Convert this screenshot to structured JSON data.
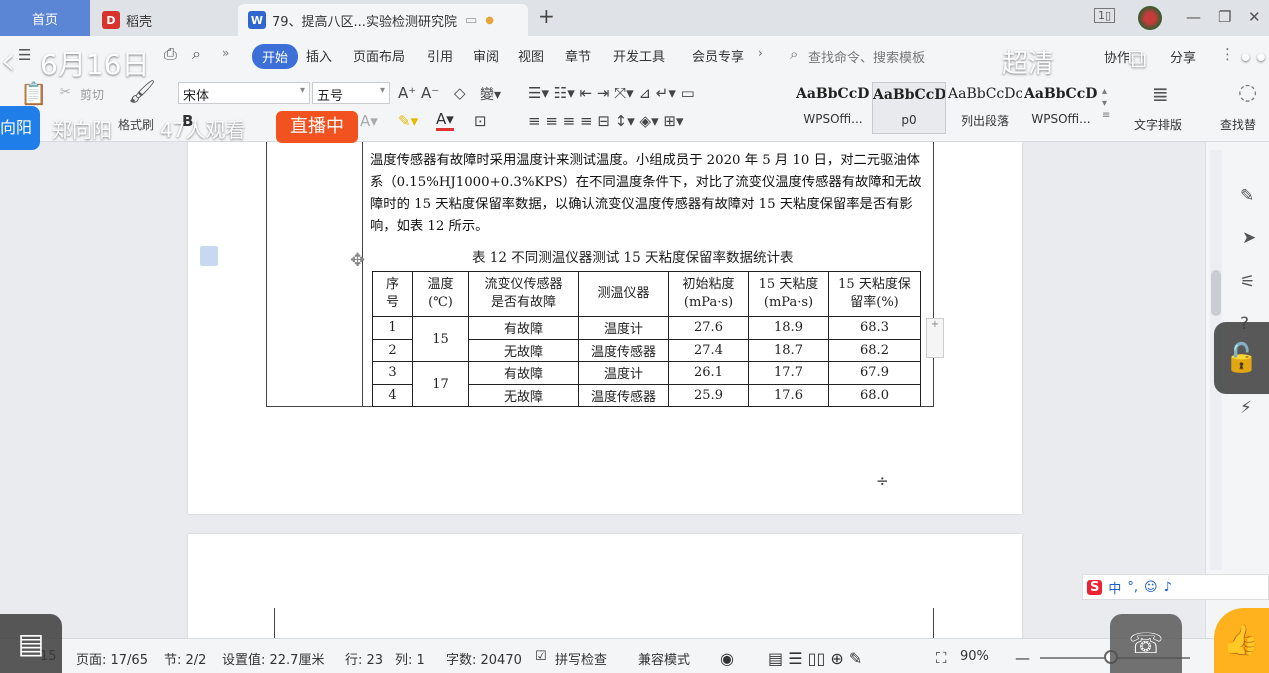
{
  "tabs": {
    "home": "首页",
    "wps": "稻壳",
    "doc": "79、提高八区...实验检测研究院",
    "add": "+"
  },
  "ribbon_tabs": [
    "开始",
    "插入",
    "页面布局",
    "引用",
    "审阅",
    "视图",
    "章节",
    "开发工具",
    "会员专享"
  ],
  "search": {
    "placeholder": "查找命令、搜索模板"
  },
  "ribbon_right": {
    "collab": "协作",
    "share": "分享"
  },
  "ribbon": {
    "cut": "剪切",
    "format_painter": "格式刷",
    "font": "宋体",
    "size": "五号",
    "styles": [
      {
        "sample": "AaBbCcDd",
        "name": "WPSOffi..."
      },
      {
        "sample": "AaBbCcDc",
        "name": "p0"
      },
      {
        "sample": "AaBbCcDc",
        "name": "列出段落"
      },
      {
        "sample": "AaBbCcDd",
        "name": "WPSOffi..."
      }
    ],
    "text_layout": "文字排版",
    "find": "查找替"
  },
  "overlay": {
    "date": "6月16日",
    "quality": "超清",
    "user_tag": "向阳",
    "user": "郑向阳",
    "viewers": "47人观看",
    "live": "直播中",
    "mini_font": "A",
    "ime": [
      "中",
      "°,",
      "☺",
      "♪"
    ]
  },
  "document": {
    "paragraph": "温度传感器有故障时采用温度计来测试温度。小组成员于 2020 年 5 月 10 日，对二元驱油体系（0.15%HJ1000+0.3%KPS）在不同温度条件下，对比了流变仪温度传感器有故障和无故障时的 15 天粘度保留率数据，以确认流变仪温度传感器有故障对 15 天粘度保留率是否有影响，如表 12 所示。",
    "caption": "表 12   不同测温仪器测试 15 天粘度保留率数据统计表",
    "table": {
      "headers": [
        "序\n号",
        "温度\n(℃)",
        "流变仪传感器\n是否有故障",
        "测温仪器",
        "初始粘度\n(mPa·s)",
        "15 天粘度\n(mPa·s)",
        "15 天粘度保\n留率(%)"
      ],
      "rows": [
        {
          "no": "1",
          "temp": "15",
          "fault": "有故障",
          "instrument": "温度计",
          "init": "27.6",
          "visc15": "18.9",
          "retention": "68.3"
        },
        {
          "no": "2",
          "temp": "",
          "fault": "无故障",
          "instrument": "温度传感器",
          "init": "27.4",
          "visc15": "18.7",
          "retention": "68.2"
        },
        {
          "no": "3",
          "temp": "17",
          "fault": "有故障",
          "instrument": "温度计",
          "init": "26.1",
          "visc15": "17.7",
          "retention": "67.9"
        },
        {
          "no": "4",
          "temp": "",
          "fault": "无故障",
          "instrument": "温度传感器",
          "init": "25.9",
          "visc15": "17.6",
          "retention": "68.0"
        }
      ]
    }
  },
  "status": {
    "page_num": "15",
    "page": "页面: 17/65",
    "section": "节: 2/2",
    "setting": "设置值: 22.7厘米",
    "row": "行: 23",
    "col": "列: 1",
    "words": "字数: 20470",
    "spell": "拼写检查",
    "compat": "兼容模式",
    "zoom": "90%"
  }
}
